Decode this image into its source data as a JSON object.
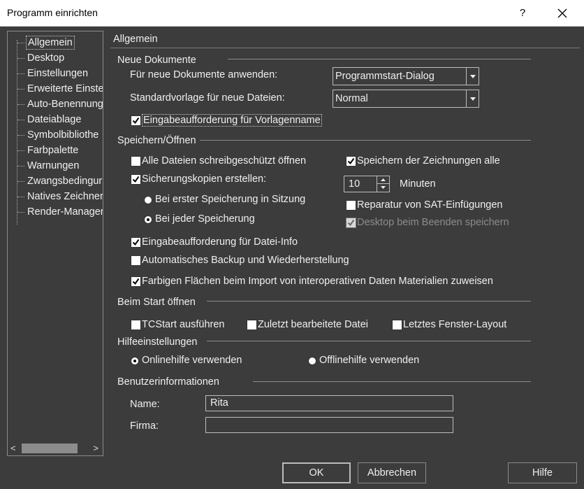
{
  "window": {
    "title": "Programm einrichten",
    "help_glyph": "?",
    "close_icon": "close-icon"
  },
  "tree": {
    "items": [
      {
        "label": "Allgemein",
        "selected": true
      },
      {
        "label": "Desktop"
      },
      {
        "label": "Einstellungen"
      },
      {
        "label": "Erweiterte Einste"
      },
      {
        "label": "Auto-Benennung"
      },
      {
        "label": "Dateiablage"
      },
      {
        "label": "Symbolbibliothe"
      },
      {
        "label": "Farbpalette"
      },
      {
        "label": "Warnungen"
      },
      {
        "label": "Zwangsbedingur"
      },
      {
        "label": "Natives Zeichner"
      },
      {
        "label": "Render-Manager"
      }
    ],
    "scroll_left": "<",
    "scroll_right": ">"
  },
  "panel": {
    "title": "Allgemein",
    "neue_dokumente": {
      "title": "Neue Dokumente",
      "anwenden_label": "Für neue Dokumente anwenden:",
      "anwenden_value": "Programmstart-Dialog",
      "vorlage_label": "Standardvorlage für neue Dateien:",
      "vorlage_value": "Normal",
      "eingabe_vorlagenname": {
        "label": "Eingabeaufforderung für Vorlagenname",
        "checked": true
      }
    },
    "speichern": {
      "title": "Speichern/Öffnen",
      "schreibgeschuetzt": {
        "label": "Alle Dateien schreibgeschützt öffnen",
        "checked": false
      },
      "sicherungskopien": {
        "label": "Sicherungskopien erstellen:",
        "checked": true
      },
      "erste_speicherung": {
        "label": "Bei erster Speicherung in Sitzung",
        "selected": false
      },
      "jede_speicherung": {
        "label": "Bei jeder Speicherung",
        "selected": true
      },
      "zeichnungen_alle": {
        "label": "Speichern der Zeichnungen alle",
        "checked": true
      },
      "minuten_value": "10",
      "minuten_label": "Minuten",
      "reparatur_sat": {
        "label": "Reparatur von SAT-Einfügungen",
        "checked": false
      },
      "desktop_beenden": {
        "label": "Desktop beim Beenden speichern",
        "checked": true,
        "disabled": true
      },
      "datei_info": {
        "label": "Eingabeaufforderung für Datei-Info",
        "checked": true
      },
      "auto_backup": {
        "label": "Automatisches Backup und Wiederherstellung",
        "checked": false
      },
      "farbige_flaechen": {
        "label": "Farbigen Flächen beim Import von interoperativen Daten Materialien zuweisen",
        "checked": true
      }
    },
    "start": {
      "title": "Beim Start öffnen",
      "tcstart": {
        "label": "TCStart ausführen",
        "checked": false
      },
      "zuletzt": {
        "label": "Zuletzt bearbeitete Datei",
        "checked": false
      },
      "fenster_layout": {
        "label": "Letztes Fenster-Layout",
        "checked": false
      }
    },
    "hilfe": {
      "title": "Hilfeeinstellungen",
      "online": {
        "label": "Onlinehilfe verwenden",
        "selected": true
      },
      "offline": {
        "label": "Offlinehilfe verwenden",
        "selected": false
      }
    },
    "benutzer": {
      "title": "Benutzerinformationen",
      "name_label": "Name:",
      "name_value": "Rita",
      "firma_label": "Firma:",
      "firma_value": ""
    }
  },
  "buttons": {
    "ok": "OK",
    "abbrechen": "Abbrechen",
    "hilfe": "Hilfe"
  }
}
